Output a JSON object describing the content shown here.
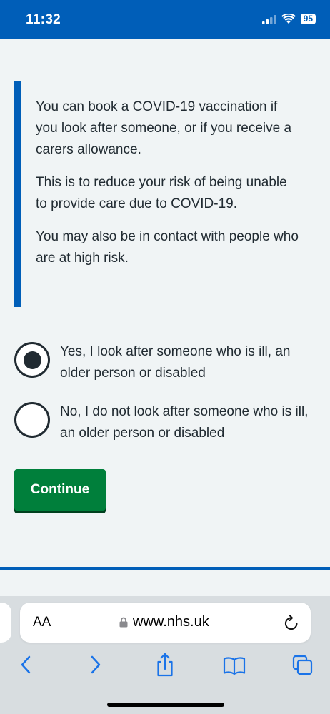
{
  "status_bar": {
    "time": "11:32",
    "battery": "95"
  },
  "inset": {
    "paragraphs": [
      "You can book a COVID-19 vaccination if you look after someone, or if you receive a carers allowance.",
      "This is to reduce your risk of being unable to provide care due to COVID-19.",
      "You may also be in contact with people who are at high risk."
    ]
  },
  "question": {
    "options": [
      {
        "label": "Yes, I look after someone who is ill, an older person or disabled",
        "selected": true
      },
      {
        "label": "No, I do not look after someone who is ill, an older person or disabled",
        "selected": false
      }
    ]
  },
  "continue_label": "Continue",
  "browser": {
    "aa_label": "AA",
    "url": "www.nhs.uk",
    "toolbar_icons": [
      "back-icon",
      "forward-icon",
      "share-icon",
      "bookmarks-icon",
      "tabs-icon"
    ]
  },
  "colors": {
    "nhs_blue": "#005eb8",
    "nhs_green": "#007f3b",
    "background": "#f0f4f5",
    "text": "#212b32"
  }
}
